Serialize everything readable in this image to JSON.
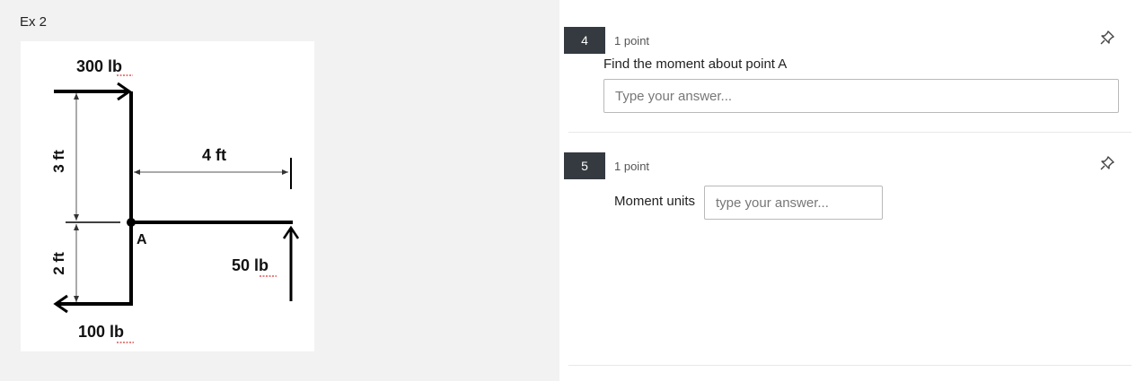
{
  "example": {
    "title": "Ex 2"
  },
  "diagram": {
    "labels": {
      "force_top": "300 lb",
      "force_bottom": "100 lb",
      "force_right": "50 lb",
      "dim_horizontal": "4 ft",
      "dim_upper": "3 ft",
      "dim_lower": "2 ft",
      "point": "A"
    }
  },
  "questions": [
    {
      "number": "4",
      "points": "1 point",
      "text": "Find the moment about point A",
      "placeholder": "Type your answer..."
    },
    {
      "number": "5",
      "points": "1 point",
      "label": "Moment units",
      "placeholder": "type your answer..."
    }
  ]
}
